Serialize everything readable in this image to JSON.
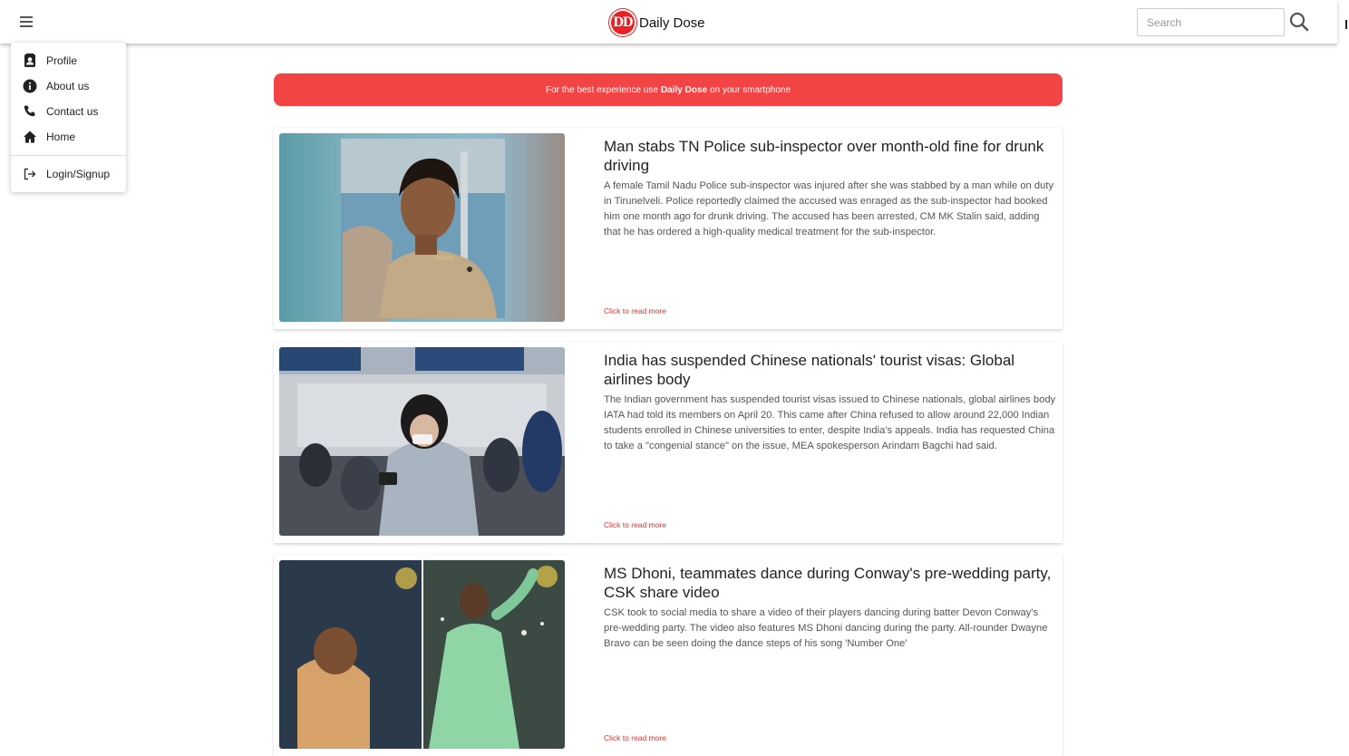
{
  "header": {
    "brand_logo_text": "DD",
    "brand_name": "Daily Dose",
    "search_placeholder": "Search"
  },
  "menu": {
    "items": [
      {
        "label": "Profile",
        "icon": "profile-icon"
      },
      {
        "label": "About us",
        "icon": "info-icon"
      },
      {
        "label": "Contact us",
        "icon": "phone-icon"
      },
      {
        "label": "Home",
        "icon": "home-icon"
      }
    ],
    "login": {
      "label": "Login/Signup",
      "icon": "login-icon"
    }
  },
  "banner": {
    "prefix": "For the best experience use",
    "brand": "Daily Dose",
    "suffix": "on your smartphone",
    "color": "#f24444"
  },
  "articles": [
    {
      "title": "Man stabs TN Police sub-inspector over month-old fine for drunk driving",
      "body": "A female Tamil Nadu Police sub-inspector was injured after she was stabbed by a man while on duty in Tirunelveli. Police reportedly claimed the accused was enraged as the sub-inspector had booked him one month ago for drunk driving. The accused has been arrested, CM MK Stalin said, adding that he has ordered a high-quality medical treatment for the sub-inspector.",
      "read_more": "Click to read more"
    },
    {
      "title": "India has suspended Chinese nationals' tourist visas: Global airlines body",
      "body": "The Indian government has suspended tourist visas issued to Chinese nationals, global airlines body IATA had told its members on April 20. This came after China refused to allow around 22,000 Indian students enrolled in Chinese universities to enter, despite India's appeals. India has requested China to take a \"congenial stance\" on the issue, MEA spokesperson Arindam Bagchi had said.",
      "read_more": "Click to read more"
    },
    {
      "title": "MS Dhoni, teammates dance during Conway's pre-wedding party, CSK share video",
      "body": "CSK took to social media to share a video of their players dancing during batter Devon Conway's pre-wedding party. The video also features MS Dhoni dancing during the party. All-rounder Dwayne Bravo can be seen doing the dance steps of his song 'Number One'",
      "read_more": "Click to read more"
    }
  ],
  "colors": {
    "accent": "#ec1f24",
    "link": "#e03030"
  }
}
